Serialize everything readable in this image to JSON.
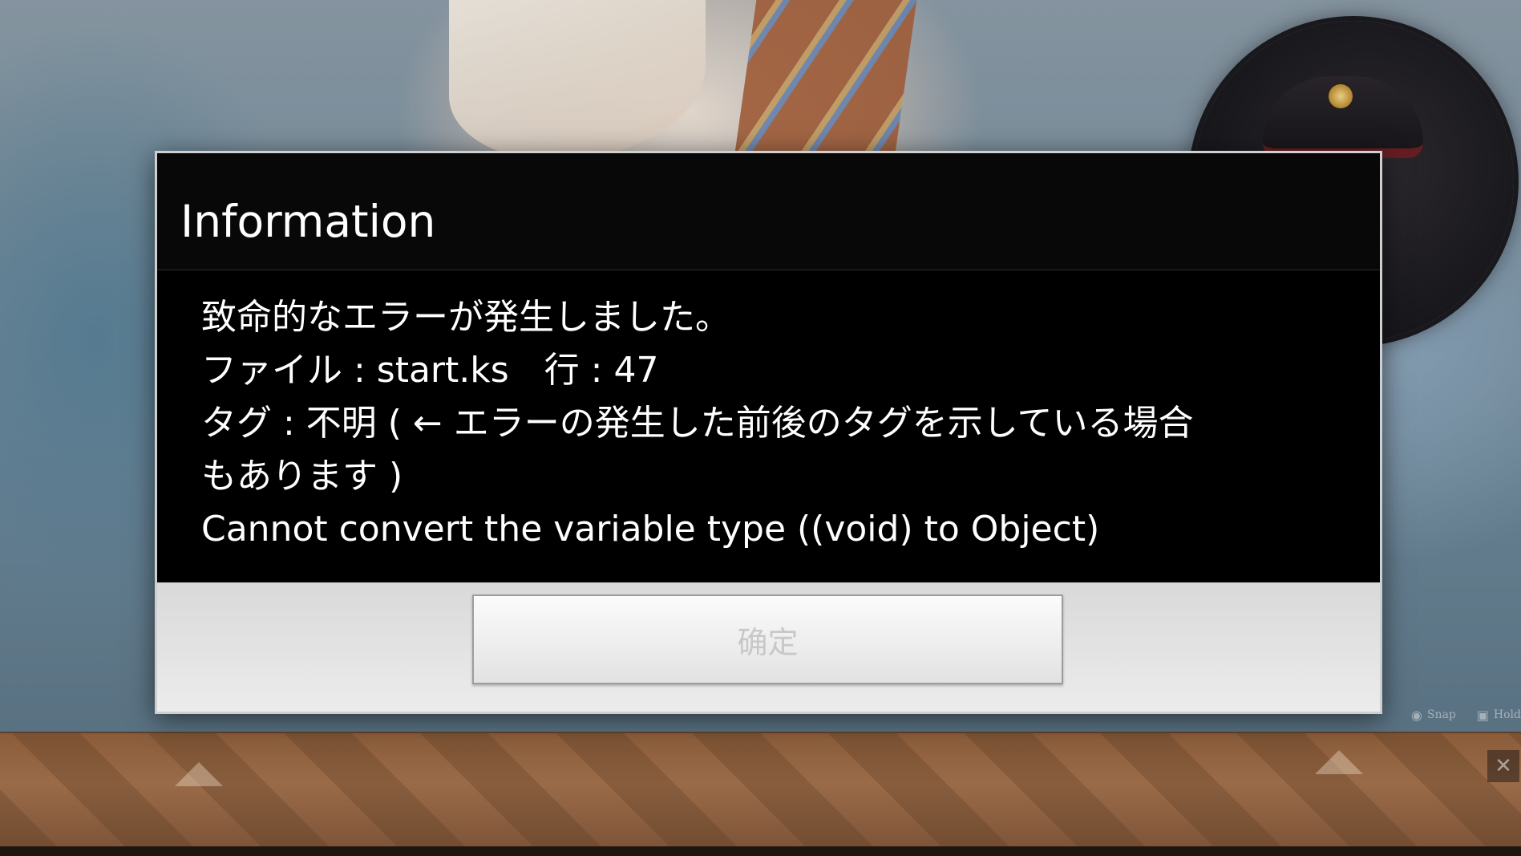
{
  "dialog": {
    "title": "Information",
    "message_lines": [
      "致命的なエラーが発生しました。",
      "ファイル : start.ks　行 : 47",
      "タグ : 不明 ( ← エラーの発生した前後のタグを示している場合",
      "もあります )",
      "Cannot convert the variable type ((void) to Object)"
    ],
    "ok_label": "确定"
  },
  "quick_menu": {
    "snap_label": "Snap",
    "hold_label": "Hold",
    "snap_icon": "camera-icon",
    "hold_icon": "lock-icon",
    "close_icon": "close-icon"
  },
  "colors": {
    "dialog_bg": "#000000",
    "dialog_border": "#cfcfcf",
    "footer_bg": "#e4e4e4",
    "text": "#ffffff",
    "button_text": "#c8c8c8"
  }
}
